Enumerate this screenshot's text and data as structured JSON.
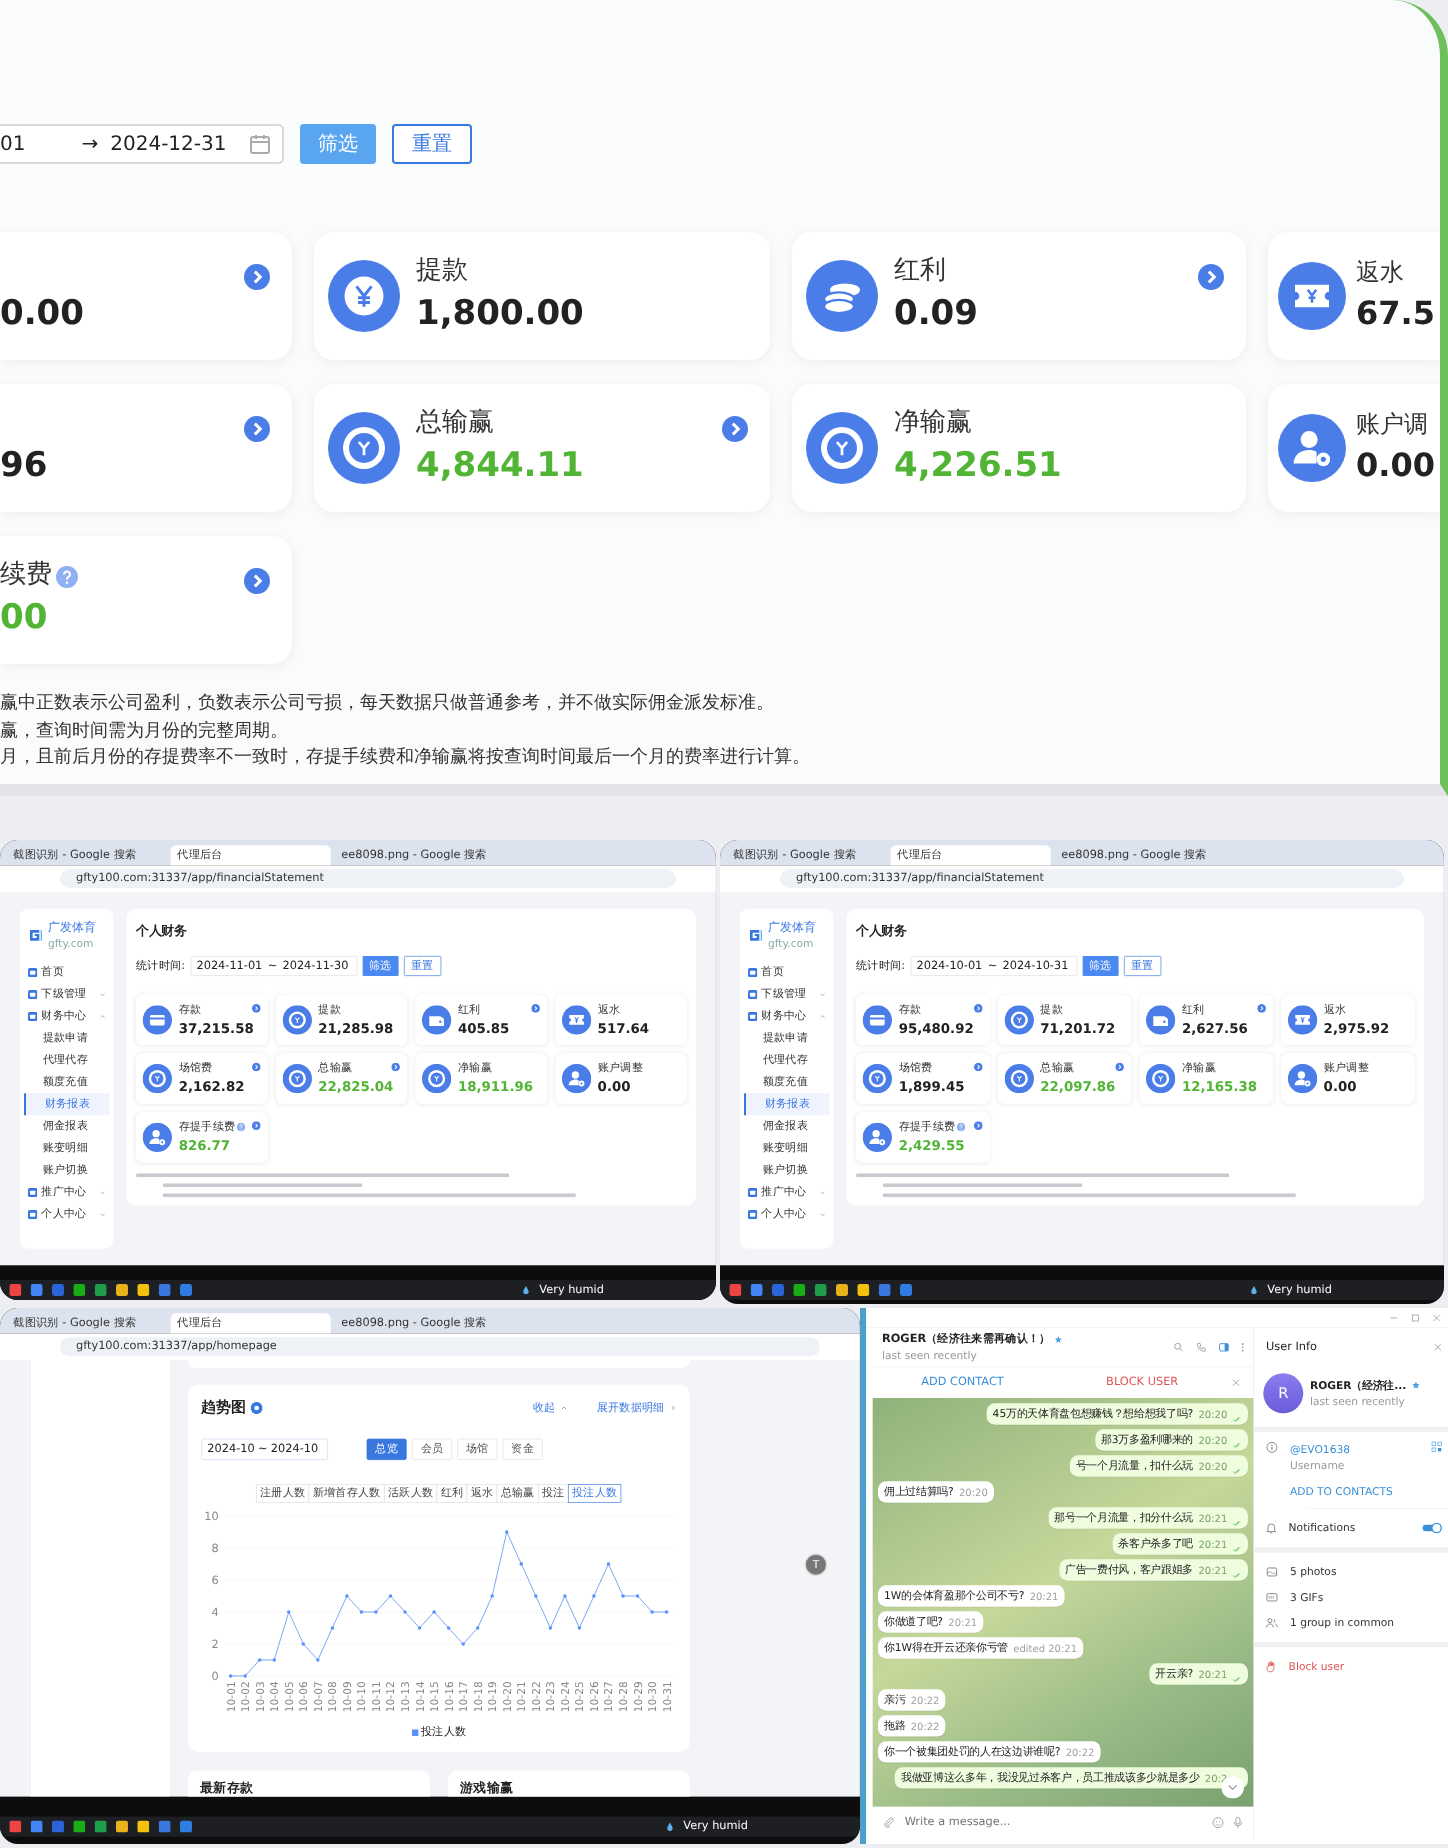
{
  "top": {
    "date_start": "01",
    "range_separator": "→",
    "date_end": "2024-12-31",
    "filter_button": "筛选",
    "reset_button": "重置",
    "cards": [
      {
        "value": "0.00",
        "color": "#222222",
        "link": true
      },
      {
        "label": "提款",
        "value": "1,800.00",
        "color": "#222222",
        "link": false
      },
      {
        "label": "红利",
        "value": "0.09",
        "color": "#222222",
        "link": true
      },
      {
        "label": "返水",
        "value": "67.5",
        "color": "#222222",
        "link": false
      },
      {
        "value": "96",
        "color": "#222222",
        "link": true
      },
      {
        "label": "总输赢",
        "value": "4,844.11",
        "color": "#52b435",
        "link": true
      },
      {
        "label": "净输赢",
        "value": "4,226.51",
        "color": "#52b435",
        "link": false
      },
      {
        "label": "账户调",
        "value": "0.00",
        "color": "#222222",
        "link": false
      },
      {
        "label": "续费",
        "help": true,
        "value": "00",
        "color": "#52b435",
        "link": true
      }
    ],
    "notes": [
      "赢中正数表示公司盈利，负数表示公司亏损，每天数据只做普通参考，并不做实际佣金派发标准。",
      "赢，查询时间需为月份的完整周期。",
      "月，且前后月份的存提费率不一致时，存提手续费和净输赢将按查询时间最后一个月的费率进行计算。"
    ]
  },
  "screens": [
    {
      "tabs": [
        {
          "title": "截图识别 - Google 搜索",
          "selected": false
        },
        {
          "title": "代理后台",
          "selected": true
        },
        {
          "title": "ee8098.png - Google 搜索",
          "selected": false
        }
      ],
      "url": "gfty100.com:31337/app/financialStatement",
      "logo_name": "广发体育",
      "logo_sub": "gfty.com",
      "menu": [
        {
          "label": "首页",
          "selected": false
        },
        {
          "label": "下级管理",
          "selected": false,
          "expanded": false
        },
        {
          "label": "财务中心",
          "selected": false,
          "expanded": true,
          "children": [
            {
              "label": "提款申请",
              "selected": false
            },
            {
              "label": "代理代存",
              "selected": false
            },
            {
              "label": "额度充值",
              "selected": false
            },
            {
              "label": "财务报表",
              "selected": true
            },
            {
              "label": "佣金报表",
              "selected": false
            },
            {
              "label": "账变明细",
              "selected": false
            },
            {
              "label": "账户切换",
              "selected": false
            }
          ]
        },
        {
          "label": "推广中心",
          "selected": false,
          "expanded": false
        },
        {
          "label": "个人中心",
          "selected": false,
          "expanded": false
        }
      ],
      "page_title": "个人财务",
      "date_label": "统计时间:",
      "date_start": "2024-11-01",
      "range_separator": "~",
      "date_end": "2024-11-30",
      "filter_button": "筛选",
      "reset_button": "重置",
      "cards": [
        {
          "label": "存款",
          "value": "37,215.58",
          "color": "#222222",
          "link": true
        },
        {
          "label": "提款",
          "value": "21,285.98",
          "color": "#222222",
          "link": false
        },
        {
          "label": "红利",
          "value": "405.85",
          "color": "#222222",
          "link": true
        },
        {
          "label": "返水",
          "value": "517.64",
          "color": "#222222",
          "link": false
        },
        {
          "label": "场馆费",
          "value": "2,162.82",
          "color": "#222222",
          "link": true
        },
        {
          "label": "总输赢",
          "value": "22,825.04",
          "color": "#52b435",
          "link": true
        },
        {
          "label": "净输赢",
          "value": "18,911.96",
          "color": "#52b435",
          "link": false
        },
        {
          "label": "账户调整",
          "value": "0.00",
          "color": "#222222",
          "link": false
        },
        {
          "label": "存提手续费",
          "help": true,
          "value": "826.77",
          "color": "#52b435",
          "link": true
        }
      ],
      "weather": "Very humid"
    },
    {
      "tabs": [
        {
          "title": "截图识别 - Google 搜索",
          "selected": false
        },
        {
          "title": "代理后台",
          "selected": true
        },
        {
          "title": "ee8098.png - Google 搜索",
          "selected": false
        }
      ],
      "url": "gfty100.com:31337/app/financialStatement",
      "logo_name": "广发体育",
      "logo_sub": "gfty.com",
      "menu": [
        {
          "label": "首页",
          "selected": false
        },
        {
          "label": "下级管理",
          "selected": false,
          "expanded": false
        },
        {
          "label": "财务中心",
          "selected": false,
          "expanded": true,
          "children": [
            {
              "label": "提款申请",
              "selected": false
            },
            {
              "label": "代理代存",
              "selected": false
            },
            {
              "label": "额度充值",
              "selected": false
            },
            {
              "label": "财务报表",
              "selected": true
            },
            {
              "label": "佣金报表",
              "selected": false
            },
            {
              "label": "账变明细",
              "selected": false
            },
            {
              "label": "账户切换",
              "selected": false
            }
          ]
        },
        {
          "label": "推广中心",
          "selected": false,
          "expanded": false
        },
        {
          "label": "个人中心",
          "selected": false,
          "expanded": false
        }
      ],
      "page_title": "个人财务",
      "date_label": "统计时间:",
      "date_start": "2024-10-01",
      "range_separator": "~",
      "date_end": "2024-10-31",
      "filter_button": "筛选",
      "reset_button": "重置",
      "cards": [
        {
          "label": "存款",
          "value": "95,480.92",
          "color": "#222222",
          "link": true
        },
        {
          "label": "提款",
          "value": "71,201.72",
          "color": "#222222",
          "link": false
        },
        {
          "label": "红利",
          "value": "2,627.56",
          "color": "#222222",
          "link": true
        },
        {
          "label": "返水",
          "value": "2,975.92",
          "color": "#222222",
          "link": false
        },
        {
          "label": "场馆费",
          "value": "1,899.45",
          "color": "#222222",
          "link": true
        },
        {
          "label": "总输赢",
          "value": "22,097.86",
          "color": "#52b435",
          "link": true
        },
        {
          "label": "净输赢",
          "value": "12,165.38",
          "color": "#52b435",
          "link": false
        },
        {
          "label": "账户调整",
          "value": "0.00",
          "color": "#222222",
          "link": false
        },
        {
          "label": "存提手续费",
          "help": true,
          "value": "2,429.55",
          "color": "#52b435",
          "link": true
        }
      ],
      "weather": "Very humid"
    }
  ],
  "trend": {
    "tabs": [
      {
        "title": "截图识别 - Google 搜索",
        "selected": false
      },
      {
        "title": "代理后台",
        "selected": true
      },
      {
        "title": "ee8098.png - Google 搜索",
        "selected": false
      }
    ],
    "url": "gfty100.com:31337/app/homepage",
    "title": "趋势图",
    "links": [
      "收起",
      "展开数据明细"
    ],
    "date_start": "2024-10",
    "range_separator": "~",
    "date_end": "2024-10",
    "segments": [
      {
        "label": "总览",
        "selected": true
      },
      {
        "label": "会员",
        "selected": false
      },
      {
        "label": "场馆",
        "selected": false
      },
      {
        "label": "资金",
        "selected": false
      }
    ],
    "metrics": [
      {
        "label": "注册人数",
        "selected": false
      },
      {
        "label": "新增首存人数",
        "selected": false
      },
      {
        "label": "活跃人数",
        "selected": false
      },
      {
        "label": "红利",
        "selected": false
      },
      {
        "label": "返水",
        "selected": false
      },
      {
        "label": "总输赢",
        "selected": false
      },
      {
        "label": "投注",
        "selected": false
      },
      {
        "label": "投注人数",
        "selected": true
      }
    ],
    "chart_data": {
      "type": "line",
      "categories": [
        "10-01",
        "10-02",
        "10-03",
        "10-04",
        "10-05",
        "10-06",
        "10-07",
        "10-08",
        "10-09",
        "10-10",
        "10-11",
        "10-12",
        "10-13",
        "10-14",
        "10-15",
        "10-16",
        "10-17",
        "10-18",
        "10-19",
        "10-20",
        "10-21",
        "10-22",
        "10-23",
        "10-24",
        "10-25",
        "10-26",
        "10-27",
        "10-28",
        "10-29",
        "10-30",
        "10-31"
      ],
      "series": [
        {
          "name": "投注人数",
          "color": "#5b8ff9",
          "values": [
            0,
            0,
            1,
            1,
            4,
            2,
            1,
            3,
            5,
            4,
            4,
            5,
            4,
            3,
            4,
            3,
            2,
            3,
            5,
            9,
            7,
            5,
            3,
            5,
            3,
            5,
            7,
            5,
            5,
            4,
            4
          ]
        }
      ],
      "ylim": [
        0,
        10
      ],
      "yticks": [
        0,
        2,
        4,
        6,
        8,
        10
      ],
      "grid": true
    },
    "bottom_cards": [
      "最新存款",
      "游戏输赢"
    ],
    "avatar": "T",
    "weather": "Very humid"
  },
  "chat": {
    "name": "ROGER（经济往来需再确认！）",
    "status": "last seen recently",
    "add_contact": "ADD CONTACT",
    "block_user": "BLOCK USER",
    "messages": [
      {
        "text": "45万的天体育盘包想赚钱？想给想我了吗?",
        "time": "20:20",
        "out": true
      },
      {
        "text": "那3万多盈利哪来的",
        "time": "20:20",
        "out": true
      },
      {
        "text": "号一个月流量，扣什么玩",
        "time": "20:20",
        "out": true
      },
      {
        "text": "佣上过结算吗?",
        "time": "20:20",
        "out": false
      },
      {
        "text": "那号一个月流量，扣分什么玩",
        "time": "20:21",
        "out": true
      },
      {
        "text": "杀客户杀多了吧",
        "time": "20:21",
        "out": true
      },
      {
        "text": "广告一费付风，客户跟姐多",
        "time": "20:21",
        "out": true
      },
      {
        "text": "1W的会体育盈那个公司不亏?",
        "time": "20:21",
        "out": false
      },
      {
        "text": "你做道了吧?",
        "time": "20:21",
        "out": false
      },
      {
        "text": "你1W得在开云还亲你亏管",
        "time": "edited 20:21",
        "out": false
      },
      {
        "text": "开云亲?",
        "time": "20:21",
        "out": true
      },
      {
        "text": "亲污",
        "time": "20:22",
        "out": false
      },
      {
        "text": "拖路",
        "time": "20:22",
        "out": false
      },
      {
        "text": "你一个被集团处罚的人在这边讲谁呢?",
        "time": "20:22",
        "out": false
      },
      {
        "text": "我做亚博这么多年，我没见过杀客户，员工推成该多少就是多少",
        "time": "20:2",
        "out": true
      }
    ],
    "input_placeholder": "Write a message...",
    "info": {
      "title": "User Info",
      "avatar": "R",
      "name": "ROGER（经济往...",
      "status": "last seen recently",
      "username": "@EVO1638",
      "username_label": "Username",
      "add_to_contacts": "ADD TO CONTACTS",
      "notifications": {
        "label": "Notifications",
        "on": true
      },
      "media": [
        "5 photos",
        "3 GIFs",
        "1 group in common"
      ],
      "block": "Block user"
    }
  }
}
